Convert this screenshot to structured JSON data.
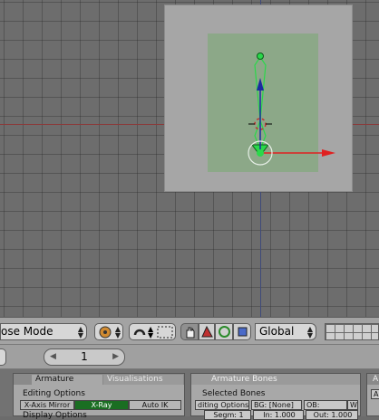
{
  "header": {
    "mode_label": "ose Mode",
    "orientation_label": "Global",
    "icons": [
      "pivot-icon",
      "snap-magnet-icon",
      "proportional-edit-icon",
      "manipulator-hand-icon",
      "translate-widget-icon",
      "rotate-widget-icon",
      "scale-widget-icon",
      "layers-grid"
    ]
  },
  "buttons_header": {
    "frame_value": "1",
    "frame_left_arrow": "◀",
    "frame_right_arrow": "▶"
  },
  "armature_panel": {
    "tabs": [
      "Armature",
      "Visualisations"
    ],
    "editing_options_label": "Editing Options",
    "buttons": [
      {
        "label": "X-Axis Mirror",
        "on": false
      },
      {
        "label": "X-Ray",
        "on": true
      },
      {
        "label": "Auto IK",
        "on": false
      }
    ],
    "display_options_label": "Display Options"
  },
  "bones_panel": {
    "tab": "Armature Bones",
    "selected_bones_label": "Selected Bones",
    "row1": {
      "editing": "diting Options",
      "bg": "BG: [None]",
      "ob": "OB:",
      "w": "W"
    },
    "row2": {
      "segm": "Segm: 1",
      "in": "In: 1.000",
      "out": "Out: 1.000"
    }
  },
  "far_panel": {
    "tab_fragment": "A",
    "button_fragment": "A"
  },
  "colors": {
    "viewport_bg": "#6d6d6d",
    "camera_frame": "#a6a6a6",
    "camera_inner": "#8ca888",
    "bone_green": "#2ad84a",
    "axis_red": "#e02020",
    "axis_blue": "#1a2aa0",
    "xray_green": "#1a6e22"
  }
}
